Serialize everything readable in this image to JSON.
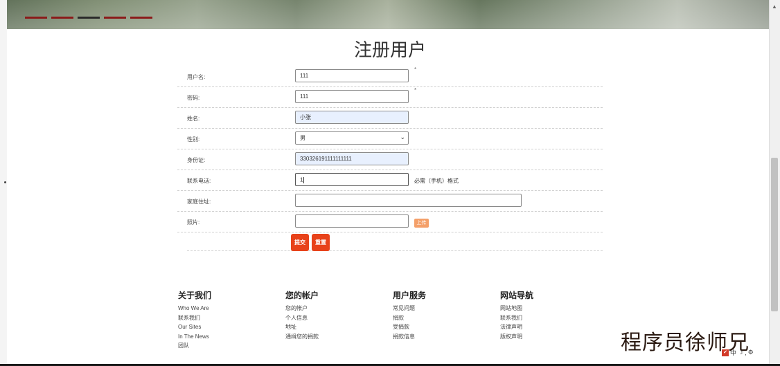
{
  "page_title": "注册用户",
  "form": {
    "username": {
      "label": "用户名:",
      "value": "111",
      "required_mark": "*"
    },
    "password": {
      "label": "密码:",
      "value": "111",
      "required_mark": "*"
    },
    "fullname": {
      "label": "姓名:",
      "value": "小张"
    },
    "gender": {
      "label": "性别:",
      "value": "男"
    },
    "id_card": {
      "label": "身份证:",
      "value": "330326191111111111"
    },
    "phone": {
      "label": "联系电话:",
      "value": "1",
      "hint": "必需（手机）格式"
    },
    "address": {
      "label": "家庭住址:",
      "value": ""
    },
    "photo": {
      "label": "照片:",
      "value": "",
      "upload_label": "上传"
    }
  },
  "actions": {
    "submit_label": "提交",
    "reset_label": "重置"
  },
  "footer": {
    "about": {
      "title": "关于我们",
      "links": [
        "Who We Are",
        "联系我们",
        "Our Sites",
        "In The News",
        "团队"
      ]
    },
    "account": {
      "title": "您的帐户",
      "links": [
        "您的帐户",
        "个人信息",
        "地址",
        "通缉您的捐款"
      ]
    },
    "service": {
      "title": "用户服务",
      "links": [
        "常见问题",
        "捐款",
        "受捐款",
        "捐款信息"
      ]
    },
    "nav": {
      "title": "网站导航",
      "links": [
        "网站地图",
        "联系我们",
        "法律声明",
        "版权声明"
      ]
    }
  },
  "watermark": "程序员徐师兄",
  "ime": {
    "mode": "中"
  },
  "colors": {
    "button": "#e8421a",
    "upload": "#f4a06a",
    "banner_bar": "#8b1a1a"
  }
}
